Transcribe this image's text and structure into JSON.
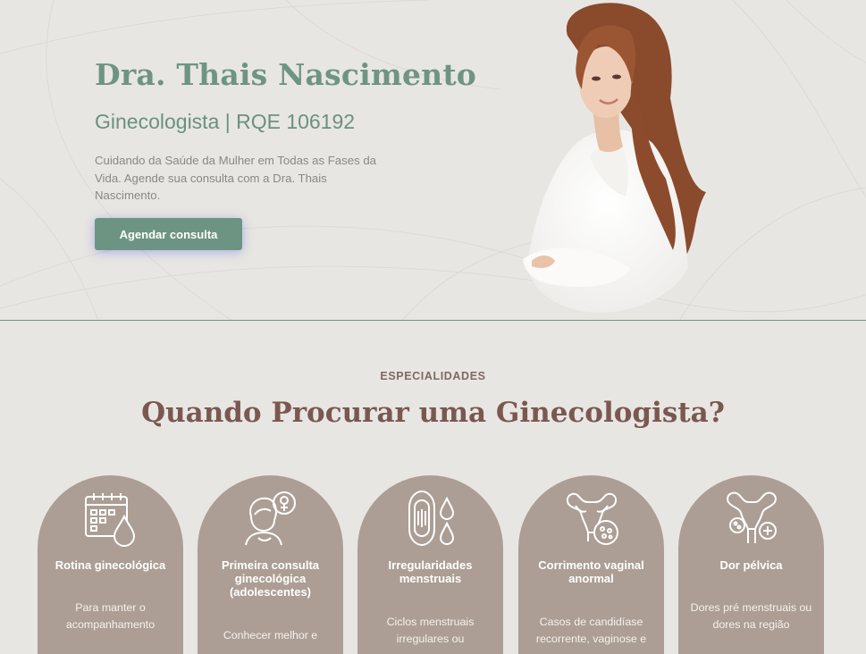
{
  "hero": {
    "name": "Dra. Thais Nascimento",
    "subtitle": "Ginecologista | RQE 106192",
    "description": "Cuidando da Saúde da Mulher em Todas as Fases da Vida. Agende sua consulta com a Dra. Thais Nascimento.",
    "cta_label": "Agendar consulta"
  },
  "specialties": {
    "label": "ESPECIALIDADES",
    "title": "Quando Procurar uma Ginecologista?",
    "cards": [
      {
        "icon": "calendar-drop-icon",
        "title": "Rotina ginecológica",
        "text": "Para manter o acompanhamento"
      },
      {
        "icon": "girl-female-symbol-icon",
        "title": "Primeira consulta ginecológica (adolescentes)",
        "text": "Conhecer melhor e"
      },
      {
        "icon": "pad-drops-icon",
        "title": "Irregularidades menstruais",
        "text": "Ciclos menstruais irregulares ou"
      },
      {
        "icon": "uterus-infection-icon",
        "title": "Corrimento vaginal anormal",
        "text": "Casos de candidíase recorrente, vaginose e"
      },
      {
        "icon": "uterus-cross-icon",
        "title": "Dor pélvica",
        "text": "Dores pré menstruais ou dores na região"
      }
    ]
  },
  "colors": {
    "accent_green": "#6d9482",
    "title_brown": "#7a5850",
    "card_bg": "#ac9e94",
    "page_bg": "#e8e6e3"
  }
}
